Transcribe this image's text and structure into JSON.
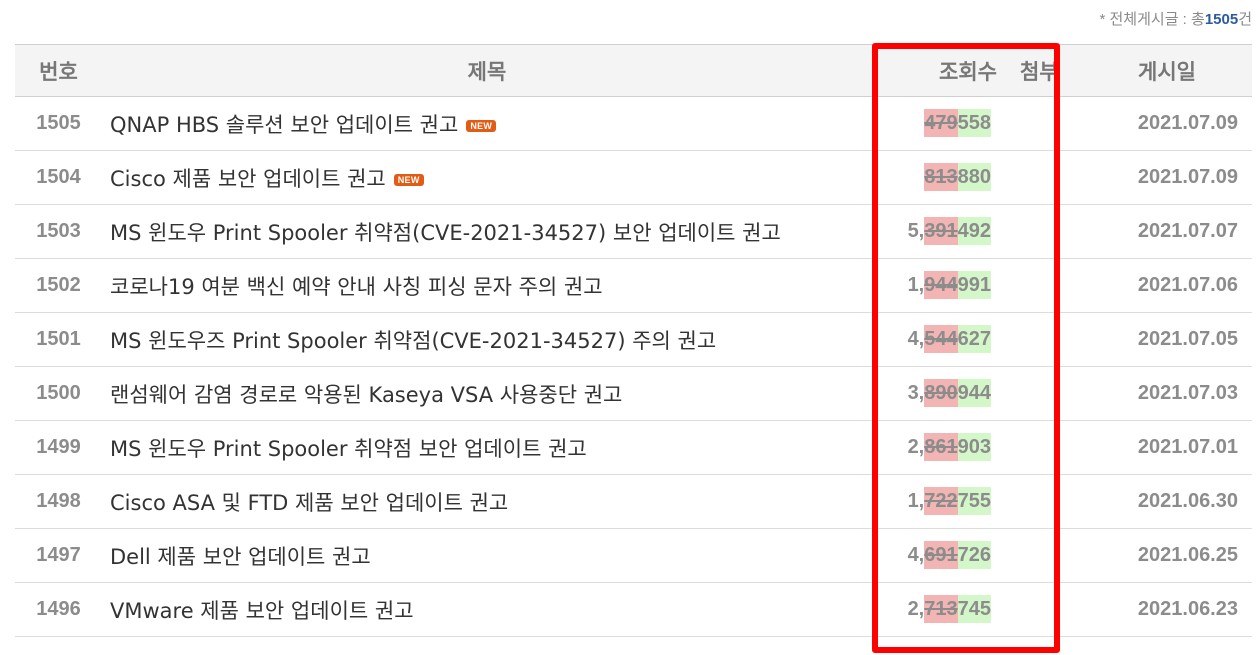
{
  "summary": {
    "prefix": "* 전체게시글 : 총",
    "count": "1505",
    "suffix": "건"
  },
  "headers": {
    "num": "번호",
    "title": "제목",
    "views": "조회수",
    "attach": "첨부",
    "date": "게시일"
  },
  "new_badge": "NEW",
  "posts": [
    {
      "num": "1505",
      "title": "QNAP HBS 솔루션 보안 업데이트 권고",
      "is_new": true,
      "views_prefix": "",
      "views_old": "479",
      "views_new": "558",
      "date": "2021.07.09"
    },
    {
      "num": "1504",
      "title": "Cisco 제품 보안 업데이트 권고",
      "is_new": true,
      "views_prefix": "",
      "views_old": "813",
      "views_new": "880",
      "date": "2021.07.09"
    },
    {
      "num": "1503",
      "title": "MS 윈도우 Print Spooler 취약점(CVE-2021-34527) 보안 업데이트 권고",
      "is_new": false,
      "views_prefix": "5,",
      "views_old": "391",
      "views_new": "492",
      "date": "2021.07.07"
    },
    {
      "num": "1502",
      "title": "코로나19 여분 백신 예약 안내 사칭 피싱 문자 주의 권고",
      "is_new": false,
      "views_prefix": "1,",
      "views_old": "944",
      "views_new": "991",
      "date": "2021.07.06"
    },
    {
      "num": "1501",
      "title": "MS 윈도우즈 Print Spooler 취약점(CVE-2021-34527) 주의 권고",
      "is_new": false,
      "views_prefix": "4,",
      "views_old": "544",
      "views_new": "627",
      "date": "2021.07.05"
    },
    {
      "num": "1500",
      "title": "랜섬웨어 감염 경로로 악용된 Kaseya VSA 사용중단 권고",
      "is_new": false,
      "views_prefix": "3,",
      "views_old": "890",
      "views_new": "944",
      "date": "2021.07.03"
    },
    {
      "num": "1499",
      "title": "MS 윈도우 Print Spooler 취약점 보안 업데이트 권고",
      "is_new": false,
      "views_prefix": "2,",
      "views_old": "861",
      "views_new": "903",
      "date": "2021.07.01"
    },
    {
      "num": "1498",
      "title": "Cisco ASA 및 FTD 제품 보안 업데이트 권고",
      "is_new": false,
      "views_prefix": "1,",
      "views_old": "722",
      "views_new": "755",
      "date": "2021.06.30"
    },
    {
      "num": "1497",
      "title": "Dell 제품 보안 업데이트 권고",
      "is_new": false,
      "views_prefix": "4,",
      "views_old": "691",
      "views_new": "726",
      "date": "2021.06.25"
    },
    {
      "num": "1496",
      "title": "VMware 제품 보안 업데이트 권고",
      "is_new": false,
      "views_prefix": "2,",
      "views_old": "713",
      "views_new": "745",
      "date": "2021.06.23"
    }
  ],
  "colors": {
    "highlight_border": "#ff0000",
    "old_value_bg": "#f3b4b4",
    "new_value_bg": "#d4f7c9",
    "new_badge_bg": "#e35c16",
    "total_count": "#2c5aa0"
  }
}
